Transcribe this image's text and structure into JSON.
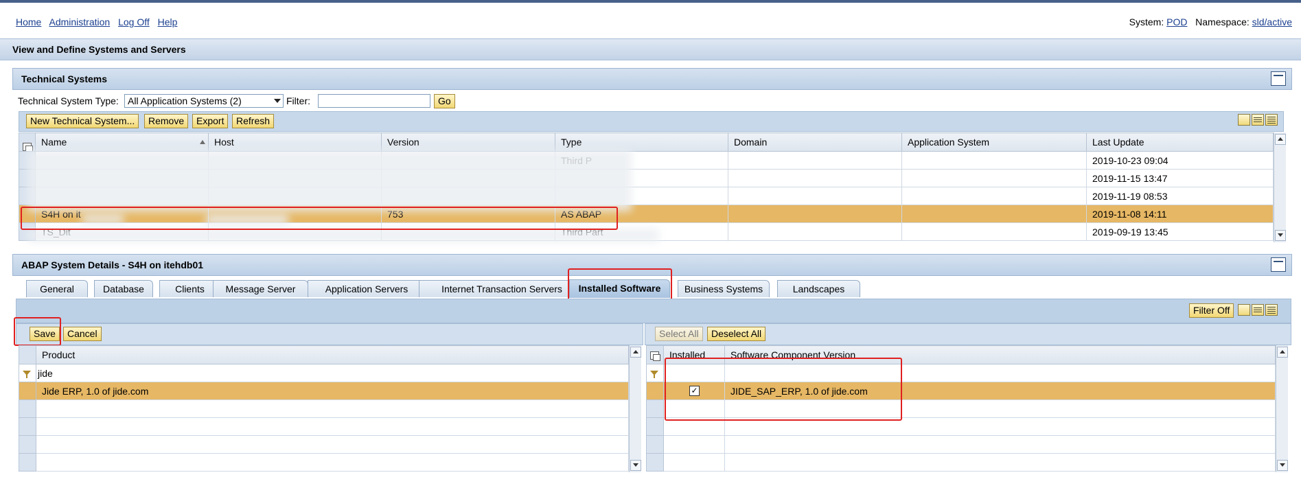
{
  "nav": {
    "links": [
      "Home",
      "Administration",
      "Log Off",
      "Help"
    ],
    "system_label": "System:",
    "system_value": "POD",
    "namespace_label": "Namespace:",
    "namespace_value": "sld/active"
  },
  "page_title": "View and Define Systems and Servers",
  "technical_systems": {
    "title": "Technical Systems",
    "type_label": "Technical System Type:",
    "type_value": "All Application Systems (2)",
    "filter_label": "Filter:",
    "filter_value": "",
    "go_label": "Go",
    "buttons": {
      "new": "New Technical System...",
      "remove": "Remove",
      "export": "Export",
      "refresh": "Refresh"
    },
    "columns": [
      "Name",
      "Host",
      "Version",
      "Type",
      "Domain",
      "Application System",
      "Last Update"
    ],
    "rows": [
      {
        "name": "",
        "host": "",
        "version": "",
        "type": "Third P",
        "domain": "",
        "app": "",
        "updated": "2019-10-23 09:04"
      },
      {
        "name": "",
        "host": "",
        "version": "",
        "type": "",
        "domain": "",
        "app": "",
        "updated": "2019-11-15 13:47"
      },
      {
        "name": "",
        "host": "",
        "version": "",
        "type": "",
        "domain": "",
        "app": "",
        "updated": "2019-11-19 08:53"
      },
      {
        "name": "S4H on it",
        "host": "",
        "version": "753",
        "type": "AS ABAP",
        "domain": "",
        "app": "",
        "updated": "2019-11-08 14:11"
      },
      {
        "name": "TS_Dit",
        "host": "",
        "version": "",
        "type": "Third Part",
        "domain": "",
        "app": "",
        "updated": "2019-09-19 13:45"
      }
    ],
    "selected_row": 3
  },
  "details": {
    "title": "ABAP System Details - S4H on itehdb01",
    "tabs": [
      "General",
      "Database",
      "Clients",
      "Message Server",
      "Application Servers",
      "Internet Transaction Servers",
      "Installed Software",
      "Business Systems",
      "Landscapes"
    ],
    "active_tab": "Installed Software",
    "filter_off_label": "Filter Off",
    "save_label": "Save",
    "cancel_label": "Cancel",
    "select_all_label": "Select All",
    "deselect_all_label": "Deselect All",
    "product_header": "Product",
    "product_filter": "jide",
    "products": [
      "Jide ERP, 1.0 of jide.com"
    ],
    "installed_header": "Installed",
    "scv_header": "Software Component Version",
    "components": [
      {
        "installed": true,
        "name": "JIDE_SAP_ERP, 1.0 of jide.com"
      }
    ]
  }
}
